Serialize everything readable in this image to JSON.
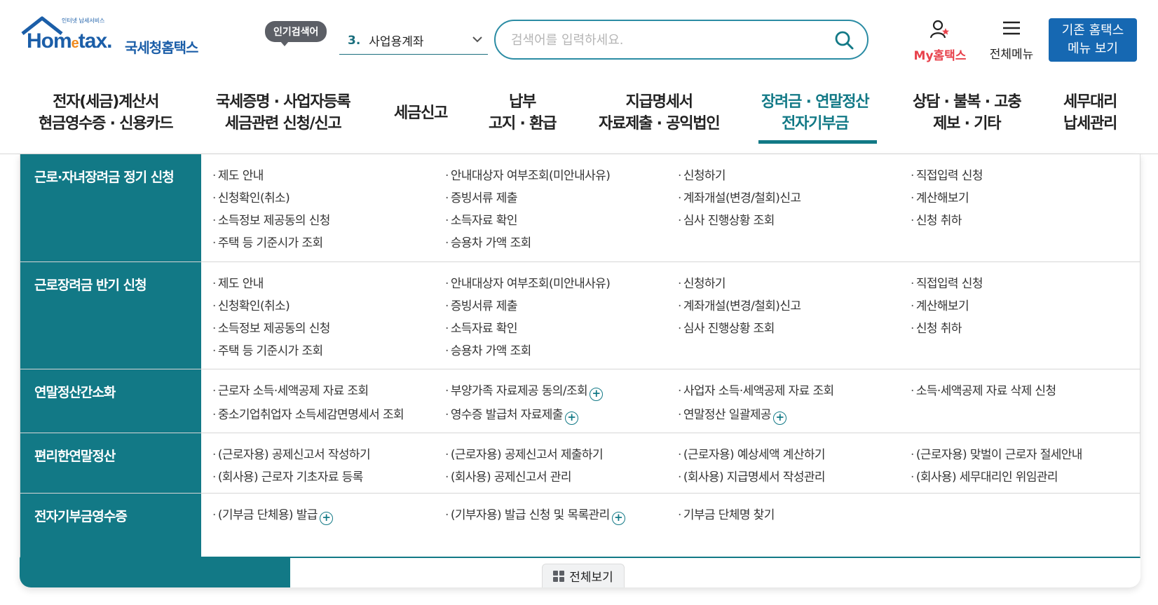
{
  "header": {
    "logo_small": "인터넷 납세서비스",
    "logo_main_pre": "Hom",
    "logo_main_e": "e",
    "logo_main_post": "tax.",
    "logo_kor": "국세청홈택스",
    "popular_badge": "인기검색어",
    "popular_rank": "3.",
    "popular_term": "사업용계좌",
    "search_placeholder": "검색어를 입력하세요.",
    "my_hometax": "My홈택스",
    "all_menu": "전체메뉴",
    "old_hometax_line1": "기존 홈택스",
    "old_hometax_line2": "메뉴 보기"
  },
  "gnb": [
    {
      "line1": "전자(세금)계산서",
      "line2": "현금영수증 · 신용카드"
    },
    {
      "line1": "국세증명 · 사업자등록",
      "line2": "세금관련 신청/신고"
    },
    {
      "line1": "세금신고",
      "line2": ""
    },
    {
      "line1": "납부",
      "line2": "고지 · 환급"
    },
    {
      "line1": "지급명세서",
      "line2": "자료제출 · 공익법인"
    },
    {
      "line1": "장려금 · 연말정산",
      "line2": "전자기부금"
    },
    {
      "line1": "상담 · 불복 · 고충",
      "line2": "제보 · 기타"
    },
    {
      "line1": "세무대리",
      "line2": "납세관리"
    }
  ],
  "menu": {
    "rows": [
      {
        "title": "근로·자녀장려금 정기 신청",
        "items": [
          "제도 안내",
          "안내대상자 여부조회(미안내사유)",
          "신청하기",
          "직접입력 신청",
          "신청확인(취소)",
          "증빙서류 제출",
          "계좌개설(변경/철회)신고",
          "계산해보기",
          "소득정보 제공동의 신청",
          "소득자료 확인",
          "심사 진행상황 조회",
          "신청 취하",
          "주택 등 기준시가 조회",
          "승용차 가액 조회"
        ]
      },
      {
        "title": "근로장려금 반기 신청",
        "items": [
          "제도 안내",
          "안내대상자 여부조회(미안내사유)",
          "신청하기",
          "직접입력 신청",
          "신청확인(취소)",
          "증빙서류 제출",
          "계좌개설(변경/철회)신고",
          "계산해보기",
          "소득정보 제공동의 신청",
          "소득자료 확인",
          "심사 진행상황 조회",
          "신청 취하",
          "주택 등 기준시가 조회",
          "승용차 가액 조회"
        ]
      },
      {
        "title": "연말정산간소화",
        "items": [
          "근로자 소득·세액공제 자료 조회",
          "부양가족 자료제공 동의/조회",
          "사업자 소득·세액공제 자료 조회",
          "소득·세액공제 자료 삭제 신청",
          "중소기업취업자 소득세감면명세서 조회",
          "영수증 발급처 자료제출",
          "연말정산 일괄제공"
        ]
      },
      {
        "title": "편리한연말정산",
        "items": [
          "(근로자용) 공제신고서 작성하기",
          "(근로자용) 공제신고서 제출하기",
          "(근로자용) 예상세액 계산하기",
          "(근로자용) 맞벌이 근로자 절세안내",
          "(회사용) 근로자 기초자료 등록",
          "(회사용) 공제신고서 관리",
          "(회사용) 지급명세서 작성관리",
          "(회사용) 세무대리인 위임관리"
        ]
      },
      {
        "title": "전자기부금영수증",
        "items": [
          "(기부금 단체용) 발급",
          "(기부자용) 발급 신청 및 목록관리",
          "기부금 단체명 찾기"
        ]
      }
    ],
    "plus_symbol": "+",
    "view_all": "전체보기"
  },
  "colors": {
    "primary_teal": "#127986",
    "brand_blue": "#1668b2",
    "my_red": "#e8424c"
  }
}
